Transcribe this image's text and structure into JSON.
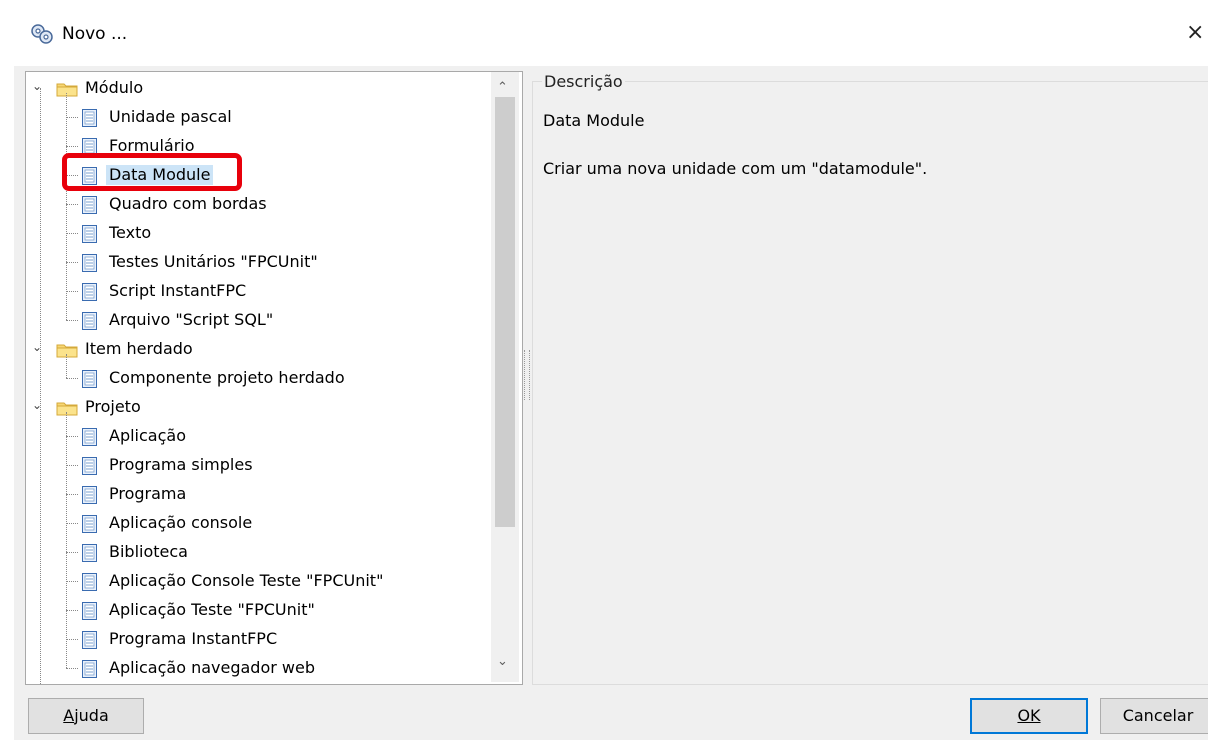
{
  "window": {
    "title": "Novo ...",
    "icon": "gear-cluster-icon",
    "close_glyph": "×"
  },
  "tree": {
    "groups": [
      {
        "label": "Módulo",
        "items": [
          "Unidade pascal",
          "Formulário",
          "Data Module",
          "Quadro com bordas",
          "Texto",
          "Testes Unitários \"FPCUnit\"",
          "Script InstantFPC",
          "Arquivo \"Script SQL\""
        ]
      },
      {
        "label": "Item herdado",
        "items": [
          "Componente projeto herdado"
        ]
      },
      {
        "label": "Projeto",
        "items": [
          "Aplicação",
          "Programa simples",
          "Programa",
          "Aplicação console",
          "Biblioteca",
          "Aplicação Console Teste \"FPCUnit\"",
          "Aplicação Teste \"FPCUnit\"",
          "Programa InstantFPC",
          "Aplicação navegador web"
        ]
      }
    ],
    "selected": "Data Module"
  },
  "description": {
    "legend": "Descrição",
    "title": "Data Module",
    "text": "Criar uma nova unidade com um \"datamodule\"."
  },
  "buttons": {
    "help": "Ajuda",
    "ok": "OK",
    "cancel": "Cancelar"
  },
  "colors": {
    "selection": "#cce4f7",
    "highlight": "#e8000b",
    "ok_border": "#0078d7"
  }
}
